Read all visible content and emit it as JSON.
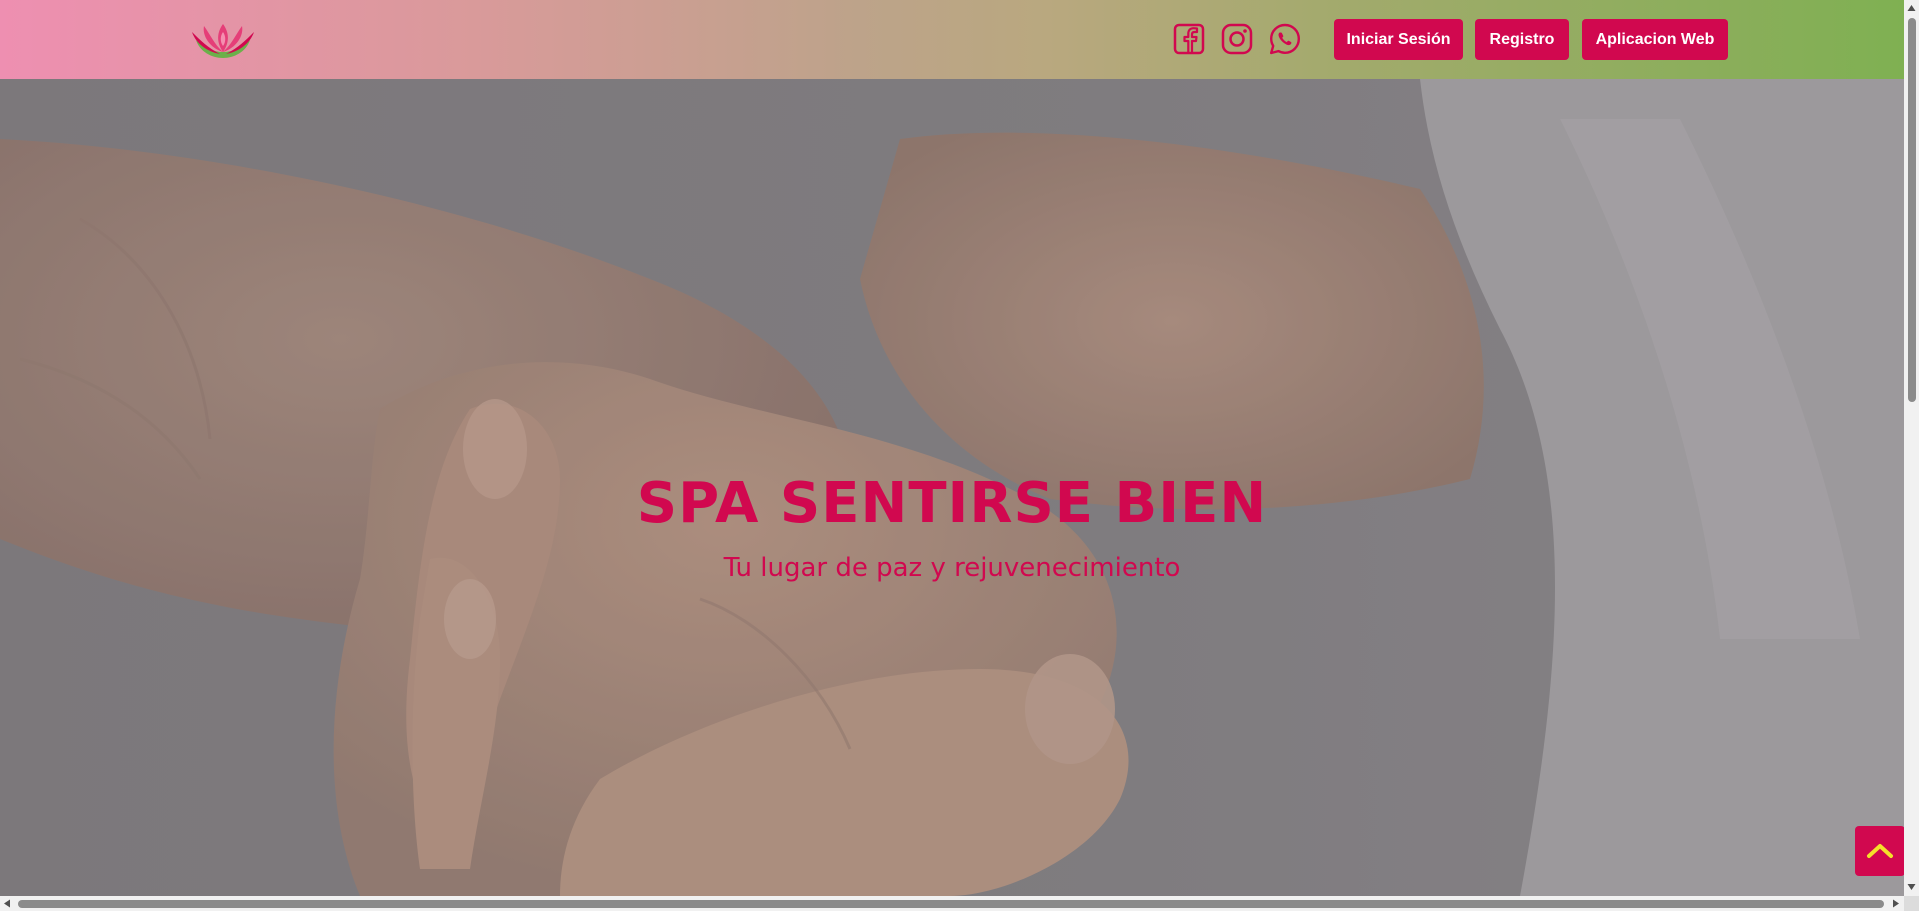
{
  "header": {
    "logo_icon": "lotus-logo-icon",
    "social": [
      {
        "name": "facebook-icon"
      },
      {
        "name": "instagram-icon"
      },
      {
        "name": "whatsapp-icon"
      }
    ],
    "buttons": {
      "login": "Iniciar Sesión",
      "register": "Registro",
      "web_app": "Aplicacion Web"
    }
  },
  "hero": {
    "title": "SPA SENTIRSE BIEN",
    "subtitle": "Tu lugar de paz y rejuvenecimiento",
    "image": "hands-massage-photo"
  },
  "scroll_top": {
    "icon": "chevron-up-icon"
  },
  "colors": {
    "accent": "#d1084f",
    "chevron": "#f4e02a",
    "gradient_left": "#ee8fb1",
    "gradient_right": "#7fb052"
  }
}
